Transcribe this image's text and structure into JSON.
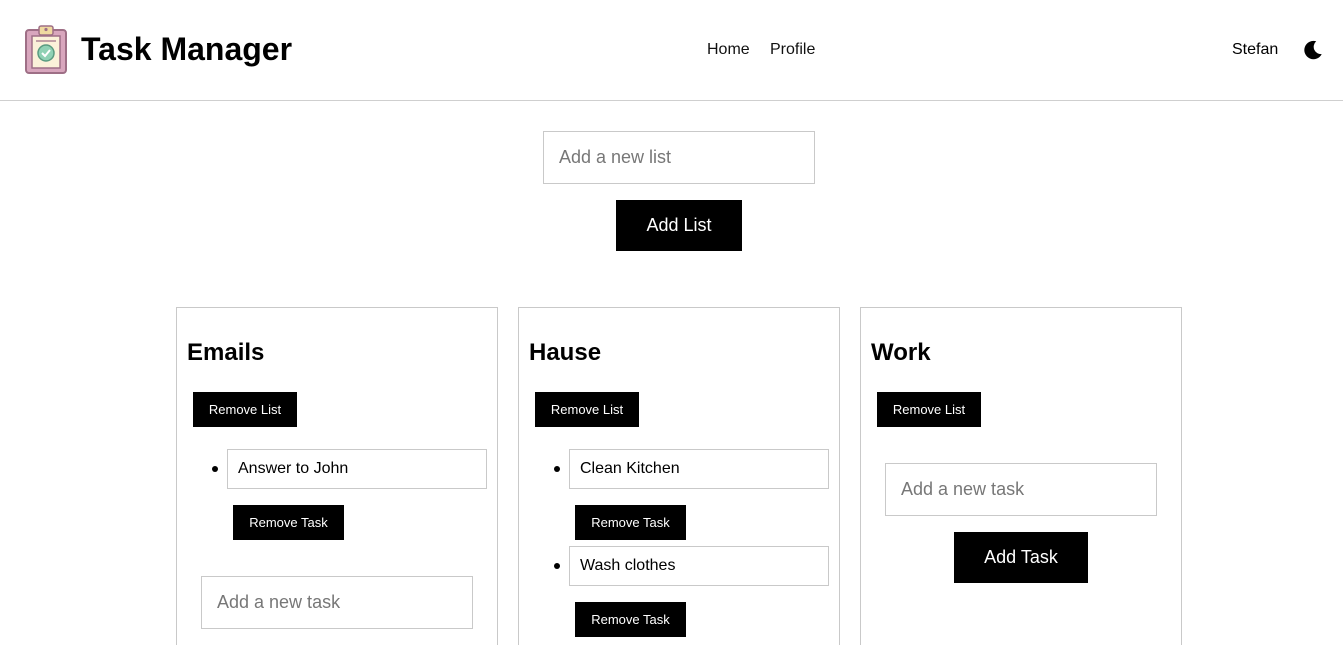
{
  "header": {
    "title": "Task Manager",
    "logo_icon": "clipboard-check-icon",
    "nav": {
      "home": "Home",
      "profile": "Profile"
    },
    "user": "Stefan",
    "theme_icon": "moon-icon"
  },
  "new_list": {
    "placeholder": "Add a new list",
    "button": "Add List"
  },
  "lists": [
    {
      "title": "Emails",
      "remove_label": "Remove List",
      "tasks": [
        {
          "text": "Answer to John",
          "remove_label": "Remove Task"
        }
      ],
      "add_placeholder": "Add a new task"
    },
    {
      "title": "Hause",
      "remove_label": "Remove List",
      "tasks": [
        {
          "text": "Clean Kitchen",
          "remove_label": "Remove Task"
        },
        {
          "text": "Wash clothes",
          "remove_label": "Remove Task"
        }
      ]
    },
    {
      "title": "Work",
      "remove_label": "Remove List",
      "tasks": [],
      "add_placeholder": "Add a new task",
      "add_button": "Add Task"
    }
  ],
  "colors": {
    "primary_button": "#000000",
    "border": "#c9c9c9",
    "logo_board": "#c98fa8",
    "logo_check": "#7fc8a9"
  }
}
